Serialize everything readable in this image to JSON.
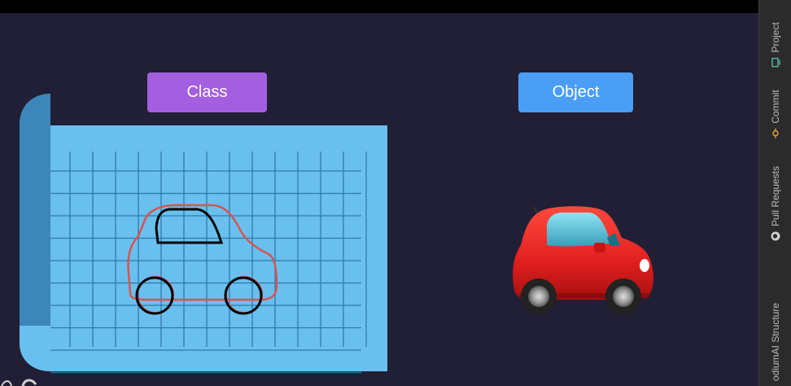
{
  "class_label": "Class",
  "object_label": "Object",
  "colors": {
    "background": "#211f35",
    "topbar": "#000000",
    "class_button": "#a45ee0",
    "object_button": "#4a9ef5",
    "blueprint_paper": "#69c0ef",
    "blueprint_roll": "#3c87b8",
    "grid_line": "#2f79a6",
    "sketch_outline": "#d8534f",
    "sketch_parts": "#000000",
    "car_body": "#e01f1f",
    "sidebar": "#2b2b2b"
  },
  "sidebar": {
    "tabs": [
      {
        "label": "Project",
        "icon": "monitor-icon"
      },
      {
        "label": "Commit",
        "icon": "commit-icon"
      },
      {
        "label": "Pull Requests",
        "icon": "github-icon"
      },
      {
        "label": "odiumAI Structure",
        "icon": ""
      }
    ]
  }
}
